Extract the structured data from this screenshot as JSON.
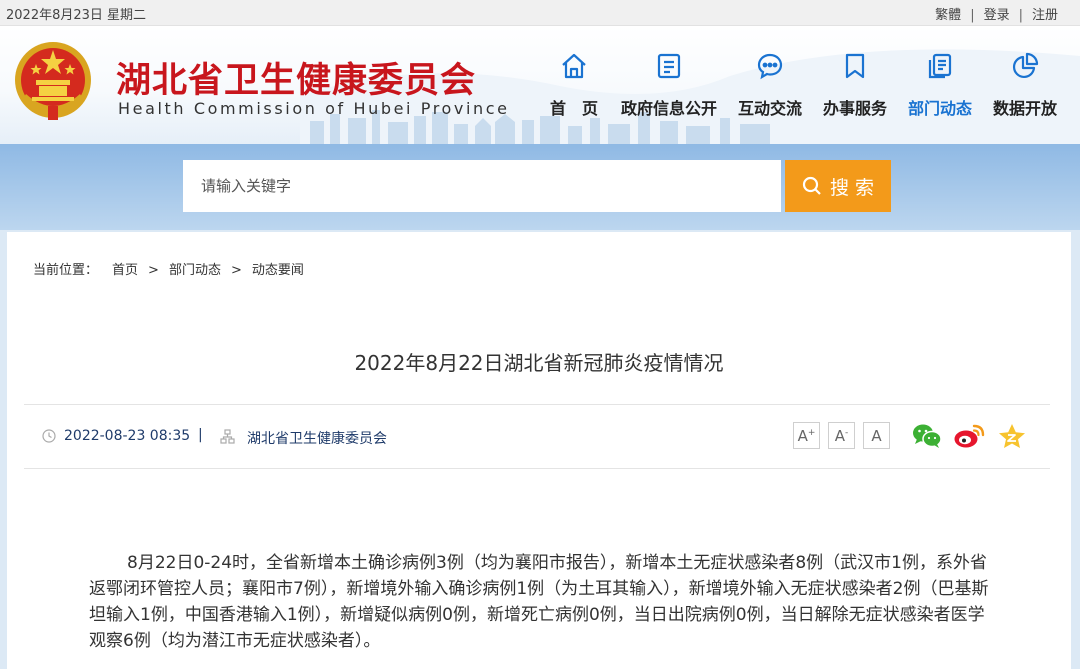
{
  "topbar": {
    "date": "2022年8月23日 星期二",
    "links": [
      "繁體",
      "登录",
      "注册"
    ],
    "separator": "|"
  },
  "header": {
    "title": "湖北省卫生健康委员会",
    "subtitle": "Health Commission of Hubei Province"
  },
  "nav": {
    "items": [
      {
        "label": "首　页",
        "icon": "home-icon"
      },
      {
        "label": "政府信息公开",
        "icon": "document-icon"
      },
      {
        "label": "互动交流",
        "icon": "chat-bubble-icon"
      },
      {
        "label": "办事服务",
        "icon": "bookmark-icon"
      },
      {
        "label": "部门动态",
        "icon": "copy-pages-icon"
      },
      {
        "label": "数据开放",
        "icon": "pie-chart-icon"
      }
    ],
    "active_index": 4
  },
  "search": {
    "placeholder": "请输入关键字",
    "button_label": "搜 索"
  },
  "breadcrumb": {
    "label": "当前位置：",
    "items": [
      "首页",
      "部门动态",
      "动态要闻"
    ],
    "separator": ">"
  },
  "article": {
    "title": "2022年8月22日湖北省新冠肺炎疫情情况",
    "date": "2022-08-23 08:35",
    "meta_separator": "|",
    "source": "湖北省卫生健康委员会",
    "font_buttons": [
      "A",
      "A",
      "A"
    ],
    "share_icons": [
      "wechat-icon",
      "weibo-icon",
      "qzone-icon"
    ],
    "body": "8月22日0-24时，全省新增本土确诊病例3例（均为襄阳市报告），新增本土无症状感染者8例（武汉市1例，系外省返鄂闭环管控人员；襄阳市7例），新增境外输入确诊病例1例（为土耳其输入），新增境外输入无症状感染者2例（巴基斯坦输入1例，中国香港输入1例），新增疑似病例0例，新增死亡病例0例，当日出院病例0例，当日解除无症状感染者医学观察6例（均为潜江市无症状感染者）。"
  },
  "colors": {
    "brand_red": "#c8161d",
    "active_blue": "#1a73d1",
    "search_orange": "#f39a1a",
    "band_blue": "#8fb9e4"
  }
}
